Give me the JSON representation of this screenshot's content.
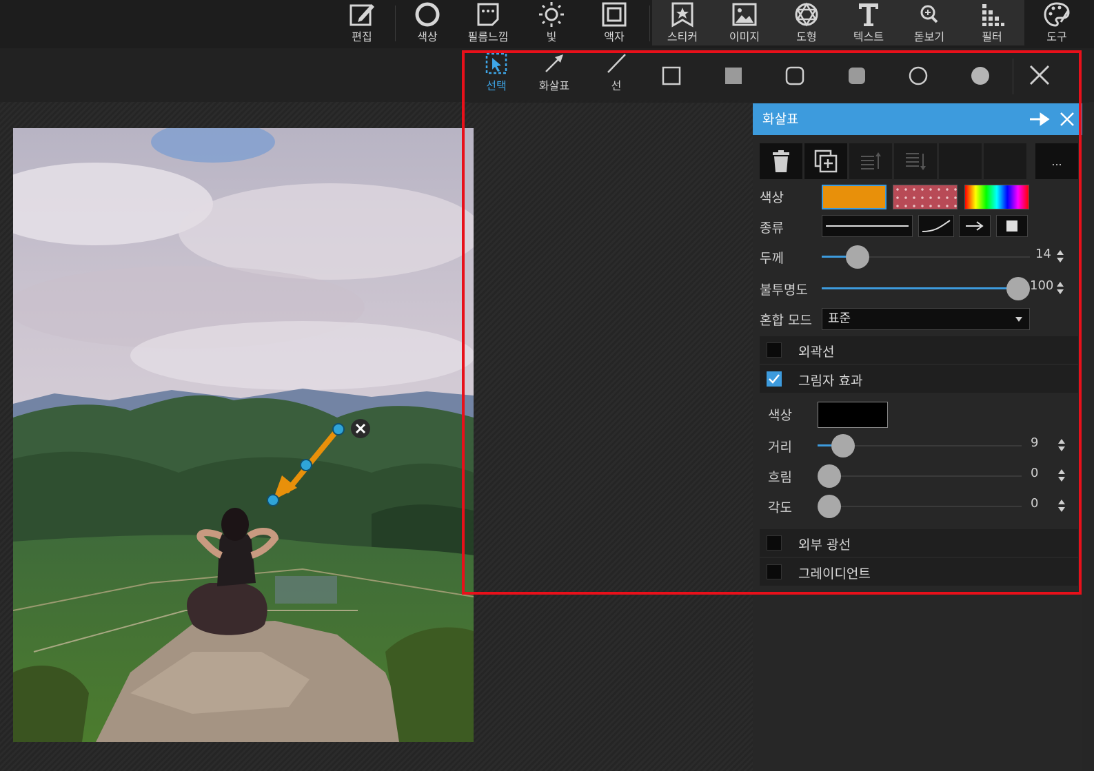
{
  "top_toolbar": {
    "items": [
      {
        "label": "편집",
        "icon": "edit-icon"
      },
      {
        "label": "색상",
        "icon": "color-circle-icon"
      },
      {
        "label": "필름느낌",
        "icon": "film-icon"
      },
      {
        "label": "빛",
        "icon": "sun-icon"
      },
      {
        "label": "액자",
        "icon": "frame-icon"
      },
      {
        "label": "스티커",
        "icon": "sticker-icon"
      },
      {
        "label": "이미지",
        "icon": "image-icon"
      },
      {
        "label": "도형",
        "icon": "shape-icon"
      },
      {
        "label": "텍스트",
        "icon": "text-icon"
      },
      {
        "label": "돋보기",
        "icon": "magnifier-icon"
      },
      {
        "label": "필터",
        "icon": "filter-icon"
      },
      {
        "label": "도구",
        "icon": "palette-icon"
      }
    ]
  },
  "shape_toolbar": {
    "select_label": "선택",
    "arrow_label": "화살표",
    "line_label": "선"
  },
  "panel": {
    "title": "화살표",
    "more_label": "...",
    "color_label": "색상",
    "type_label": "종류",
    "thickness_label": "두께",
    "thickness_value": "14",
    "opacity_label": "불투명도",
    "opacity_value": "100",
    "blend_label": "혼합 모드",
    "blend_value": "표준",
    "outline_label": "외곽선",
    "shadow_label": "그림자 효과",
    "shadow": {
      "color_label": "색상",
      "distance_label": "거리",
      "distance_value": "9",
      "blur_label": "흐림",
      "blur_value": "0",
      "angle_label": "각도",
      "angle_value": "0"
    },
    "outer_glow_label": "외부 광선",
    "gradient_label": "그레이디언트"
  },
  "colors": {
    "accent": "#3d9bdd",
    "arrow": "#e8900a",
    "highlight": "#e8101a"
  }
}
